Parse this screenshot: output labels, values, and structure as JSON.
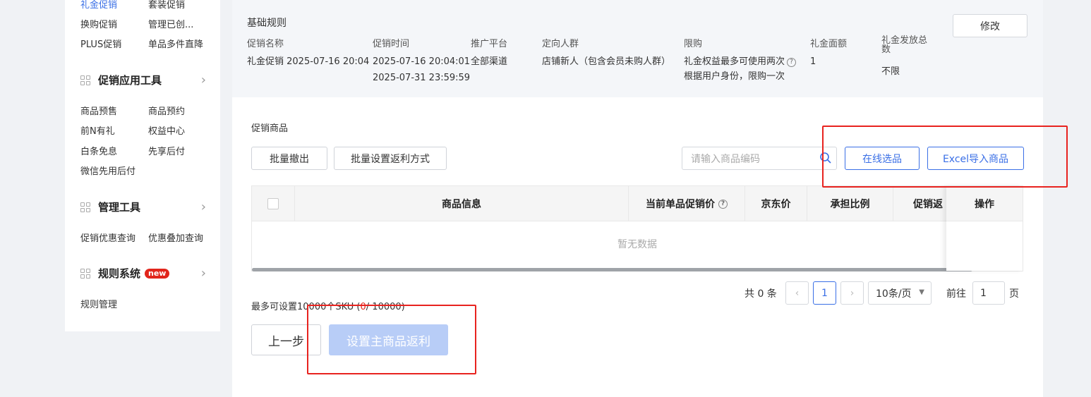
{
  "sidebar": {
    "top_items": [
      [
        "礼金促销",
        "套装促销"
      ],
      [
        "换购促销",
        "管理已创..."
      ],
      [
        "PLUS促销",
        "单品多件直降"
      ]
    ],
    "sections": [
      {
        "title": "促销应用工具",
        "items": [
          [
            "商品预售",
            "商品预约"
          ],
          [
            "前N有礼",
            "权益中心"
          ],
          [
            "白条免息",
            "先享后付"
          ],
          [
            "微信先用后付",
            ""
          ]
        ]
      },
      {
        "title": "管理工具",
        "items": [
          [
            "促销优惠查询",
            "优惠叠加查询"
          ]
        ]
      },
      {
        "title": "规则系统",
        "badge": "new",
        "items": [
          [
            "规则管理",
            ""
          ]
        ]
      }
    ]
  },
  "rules": {
    "title": "基础规则",
    "edit_label": "修改",
    "headers": [
      "促销名称",
      "促销时间",
      "推广平台",
      "定向人群",
      "限购",
      "礼金面额",
      "礼金发放总数"
    ],
    "values": {
      "name": "礼金促销 2025-07-16 20:04",
      "time_start": "2025-07-16 20:04:01",
      "time_end": "2025-07-31 23:59:59",
      "platform": "全部渠道",
      "audience": "店铺新人（包含会员未购人群）",
      "limit_line1": "礼金权益最多可使用两次",
      "limit_line2": "根据用户身份，限购一次",
      "face_value": "1",
      "total": "不限"
    }
  },
  "products": {
    "section_label": "促销商品",
    "batch_withdraw": "批量撤出",
    "batch_rebate": "批量设置返利方式",
    "search_placeholder": "请输入商品编码",
    "online_select": "在线选品",
    "excel_import": "Excel导入商品",
    "columns": [
      "商品信息",
      "当前单品促销价",
      "京东价",
      "承担比例",
      "促销返",
      "操作"
    ],
    "empty_text": "暂无数据"
  },
  "pagination": {
    "total_text": "共 0 条",
    "current_page": "1",
    "page_size": "10条/页",
    "goto_label": "前往",
    "goto_value": "1",
    "page_unit": "页",
    "prev_icon": "chevron-left-icon",
    "next_icon": "chevron-right-icon"
  },
  "footer": {
    "limit_prefix": "最多可设置10000个SKU (",
    "limit_count": "0",
    "limit_suffix": "/ 10000)",
    "prev_step": "上一步",
    "set_main_rebate": "设置主商品返利"
  },
  "colors": {
    "accent": "#3a6fe6",
    "annotation_red": "#e8231f",
    "badge_red": "#e1251b"
  }
}
